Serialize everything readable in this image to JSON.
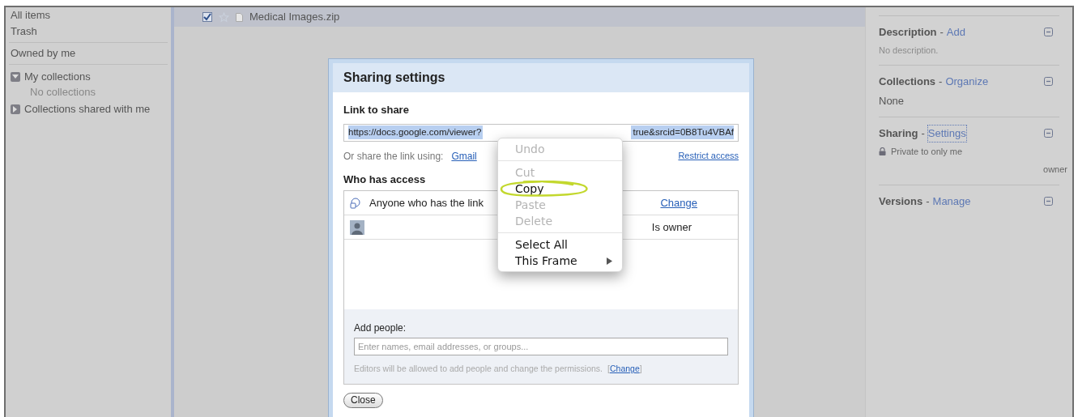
{
  "sidebar": {
    "items": [
      {
        "kind": "link",
        "label": "All items"
      },
      {
        "kind": "link",
        "label": "Trash"
      },
      {
        "kind": "divider"
      },
      {
        "kind": "link",
        "label": "Owned by me"
      },
      {
        "kind": "divider"
      },
      {
        "kind": "group",
        "label": "My collections",
        "expanded": true,
        "children": [
          {
            "kind": "empty",
            "label": "No collections"
          }
        ]
      },
      {
        "kind": "group",
        "label": "Collections shared with me",
        "expanded": false
      }
    ]
  },
  "file_row": {
    "name": "Medical Images.zip",
    "checked": true,
    "starred": false
  },
  "details_panel": {
    "sections": [
      {
        "title": "Description",
        "separator": "-",
        "action": "Add",
        "focused": false,
        "lines": [
          {
            "kind": "note",
            "text": "No description."
          }
        ]
      },
      {
        "title": "Collections",
        "separator": "-",
        "action": "Organize",
        "focused": false,
        "lines": [
          {
            "kind": "text",
            "text": "None"
          }
        ]
      },
      {
        "title": "Sharing",
        "separator": "-",
        "action": "Settings",
        "focused": true,
        "lines": [
          {
            "kind": "lock",
            "text": "Private to only me"
          },
          {
            "kind": "role",
            "text": "owner"
          }
        ]
      },
      {
        "title": "Versions",
        "separator": "-",
        "action": "Manage",
        "focused": false
      }
    ]
  },
  "dialog": {
    "title": "Sharing settings",
    "link_label": "Link to share",
    "link_start": "https://docs.google.com/viewer?",
    "link_end": "true&srcid=0B8Tu4VBAf",
    "share_using_label": "Or share the link using:",
    "share_links": [
      "Gmail"
    ],
    "restrict_access": "Restrict access",
    "access_label": "Who has access",
    "access_rows": [
      {
        "kind": "link",
        "text": "Anyone who has the link",
        "action": "Change"
      },
      {
        "kind": "person",
        "role": "Is owner"
      }
    ],
    "add_people_label": "Add people:",
    "add_people_placeholder": "Enter names, email addresses, or groups...",
    "editors_note": "Editors will be allowed to add people and change the permissions.",
    "editors_brackets": [
      "[",
      "]"
    ],
    "editors_link": "Change",
    "close": "Close"
  },
  "context_menu": {
    "items": [
      {
        "kind": "item",
        "label": "Undo",
        "disabled": true,
        "circled": false
      },
      {
        "kind": "separator"
      },
      {
        "kind": "item",
        "label": "Cut",
        "disabled": true,
        "circled": false
      },
      {
        "kind": "item",
        "label": "Copy",
        "disabled": false,
        "circled": true
      },
      {
        "kind": "item",
        "label": "Paste",
        "disabled": true,
        "circled": false
      },
      {
        "kind": "item",
        "label": "Delete",
        "disabled": true,
        "circled": false
      },
      {
        "kind": "separator"
      },
      {
        "kind": "item",
        "label": "Select All",
        "disabled": false,
        "circled": false
      },
      {
        "kind": "submenu",
        "label": "This Frame",
        "disabled": false,
        "circled": false
      }
    ]
  }
}
